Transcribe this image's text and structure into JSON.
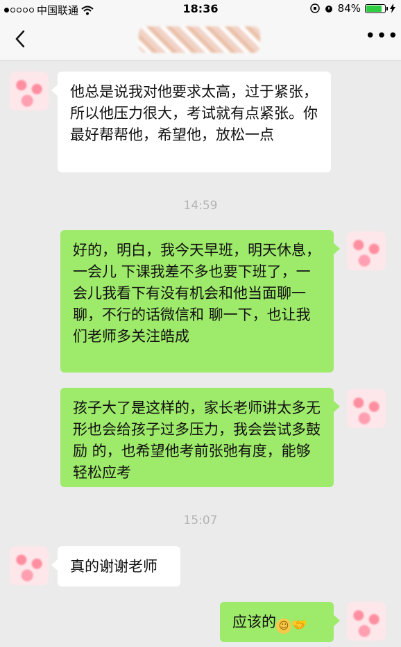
{
  "status_bar": {
    "carrier": "中国联通",
    "time": "18:36",
    "battery_percent": "84%",
    "battery_level": 0.84
  },
  "nav": {
    "back_icon": "chevron-left-icon",
    "more_icon": "more-dots-icon",
    "more_label": "•••"
  },
  "messages": [
    {
      "side": "left",
      "text": "他总是说我对他要求太高，过于紧张，所以他压力很大，考试就有点紧张。你最好帮帮他，希望他，放松一点"
    },
    {
      "timestamp": "14:59"
    },
    {
      "side": "right",
      "text": "好的，明白，我今天早班，明天休息，一会儿  下课我差不多也要下班了，一会儿我看下有没有机会和他当面聊一聊，不行的话微信和  聊一下，也让我们老师多关注皓成"
    },
    {
      "side": "right",
      "text": "孩子大了是这样的，家长老师讲太多无形也会给孩子过多压力，我会尝试多鼓励  的，也希望他考前张弛有度，能够轻松应考"
    },
    {
      "timestamp": "15:07"
    },
    {
      "side": "left",
      "text": "真的谢谢老师"
    },
    {
      "side": "right",
      "text": "应该的"
    }
  ],
  "emoji": {
    "smile": "☺",
    "handshake": "🤝"
  }
}
